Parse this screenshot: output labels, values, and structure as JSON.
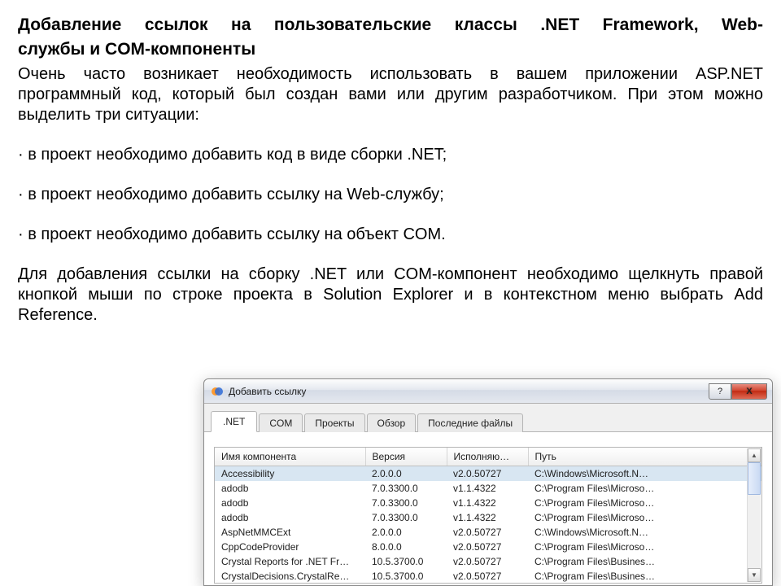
{
  "doc": {
    "heading_l1": "Добавление ссылок на пользовательские классы .NET Framework, Web-",
    "heading_l2": "службы и COM-компоненты",
    "para1": "Очень часто возникает необходимость использовать в вашем приложении ASP.NET программный код, который был создан вами или другим разработчиком. При этом можно выделить три ситуации:",
    "bullets": [
      "· в проект необходимо добавить код в виде сборки .NET;",
      "· в проект необходимо добавить ссылку на Web-службу;",
      "· в проект необходимо добавить ссылку на объект COM."
    ],
    "para2": "Для добавления ссылки на сборку .NET или COM-компонент необходимо щелкнуть правой кнопкой мыши по строке проекта в Solution Explorer и в контекстном меню выбрать Add Reference."
  },
  "dialog": {
    "title": "Добавить ссылку",
    "help_symbol": "?",
    "close_symbol": "X",
    "tabs": [
      ".NET",
      "COM",
      "Проекты",
      "Обзор",
      "Последние файлы"
    ],
    "columns": [
      "Имя компонента",
      "Версия",
      "Исполняю…",
      "Путь"
    ],
    "rows": [
      {
        "name": "Accessibility",
        "ver": "2.0.0.0",
        "run": "v2.0.50727",
        "path": "C:\\Windows\\Microsoft.N…",
        "selected": true
      },
      {
        "name": "adodb",
        "ver": "7.0.3300.0",
        "run": "v1.1.4322",
        "path": "C:\\Program Files\\Microso…",
        "selected": false
      },
      {
        "name": "adodb",
        "ver": "7.0.3300.0",
        "run": "v1.1.4322",
        "path": "C:\\Program Files\\Microso…",
        "selected": false
      },
      {
        "name": "adodb",
        "ver": "7.0.3300.0",
        "run": "v1.1.4322",
        "path": "C:\\Program Files\\Microso…",
        "selected": false
      },
      {
        "name": "AspNetMMCExt",
        "ver": "2.0.0.0",
        "run": "v2.0.50727",
        "path": "C:\\Windows\\Microsoft.N…",
        "selected": false
      },
      {
        "name": "CppCodeProvider",
        "ver": "8.0.0.0",
        "run": "v2.0.50727",
        "path": "C:\\Program Files\\Microso…",
        "selected": false
      },
      {
        "name": "Crystal Reports for .NET Fr…",
        "ver": "10.5.3700.0",
        "run": "v2.0.50727",
        "path": "C:\\Program Files\\Busines…",
        "selected": false
      },
      {
        "name": "CrystalDecisions.CrystalRe…",
        "ver": "10.5.3700.0",
        "run": "v2.0.50727",
        "path": "C:\\Program Files\\Busines…",
        "selected": false
      }
    ]
  }
}
